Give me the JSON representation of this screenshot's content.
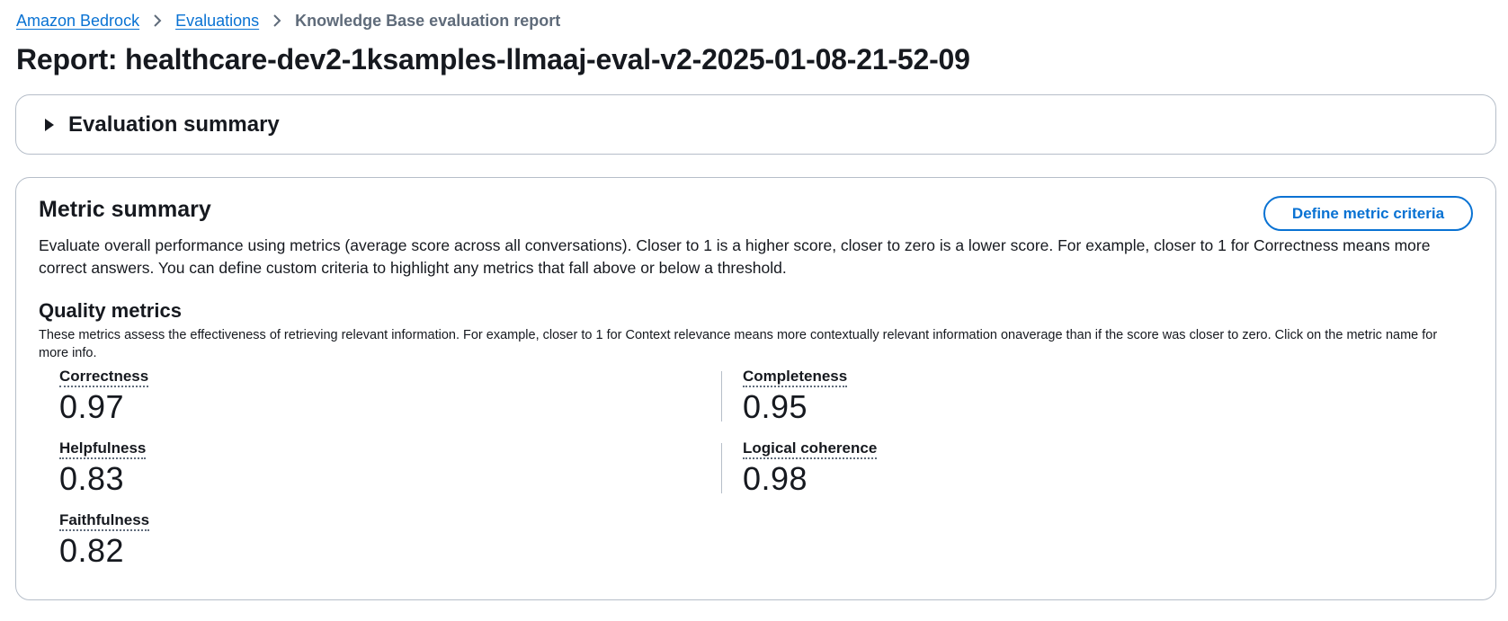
{
  "breadcrumb": {
    "items": [
      "Amazon Bedrock",
      "Evaluations"
    ],
    "current": "Knowledge Base evaluation report"
  },
  "title": "Report: healthcare-dev2-1ksamples-llmaaj-eval-v2-2025-01-08-21-52-09",
  "evaluation_summary": {
    "label": "Evaluation summary",
    "expanded": false
  },
  "metric_summary": {
    "title": "Metric summary",
    "define_button": "Define metric criteria",
    "description": "Evaluate overall performance using metrics (average score across all conversations). Closer to 1 is a higher score, closer to zero is a lower score. For example, closer to 1 for Correctness means more correct answers. You can define custom criteria to highlight any metrics that fall above or below a threshold."
  },
  "quality_metrics": {
    "title": "Quality metrics",
    "description": "These metrics assess the effectiveness of retrieving relevant information. For example, closer to 1 for Context relevance means more contextually relevant information onaverage than if the score was closer to zero. Click on the metric name for more info.",
    "metrics": [
      {
        "label": "Correctness",
        "value": "0.97"
      },
      {
        "label": "Completeness",
        "value": "0.95"
      },
      {
        "label": "Helpfulness",
        "value": "0.83"
      },
      {
        "label": "Logical coherence",
        "value": "0.98"
      },
      {
        "label": "Faithfulness",
        "value": "0.82"
      }
    ]
  },
  "colors": {
    "link": "#0972d3",
    "border": "#b6bec9",
    "text": "#16191f",
    "muted": "#5f6b7a"
  }
}
